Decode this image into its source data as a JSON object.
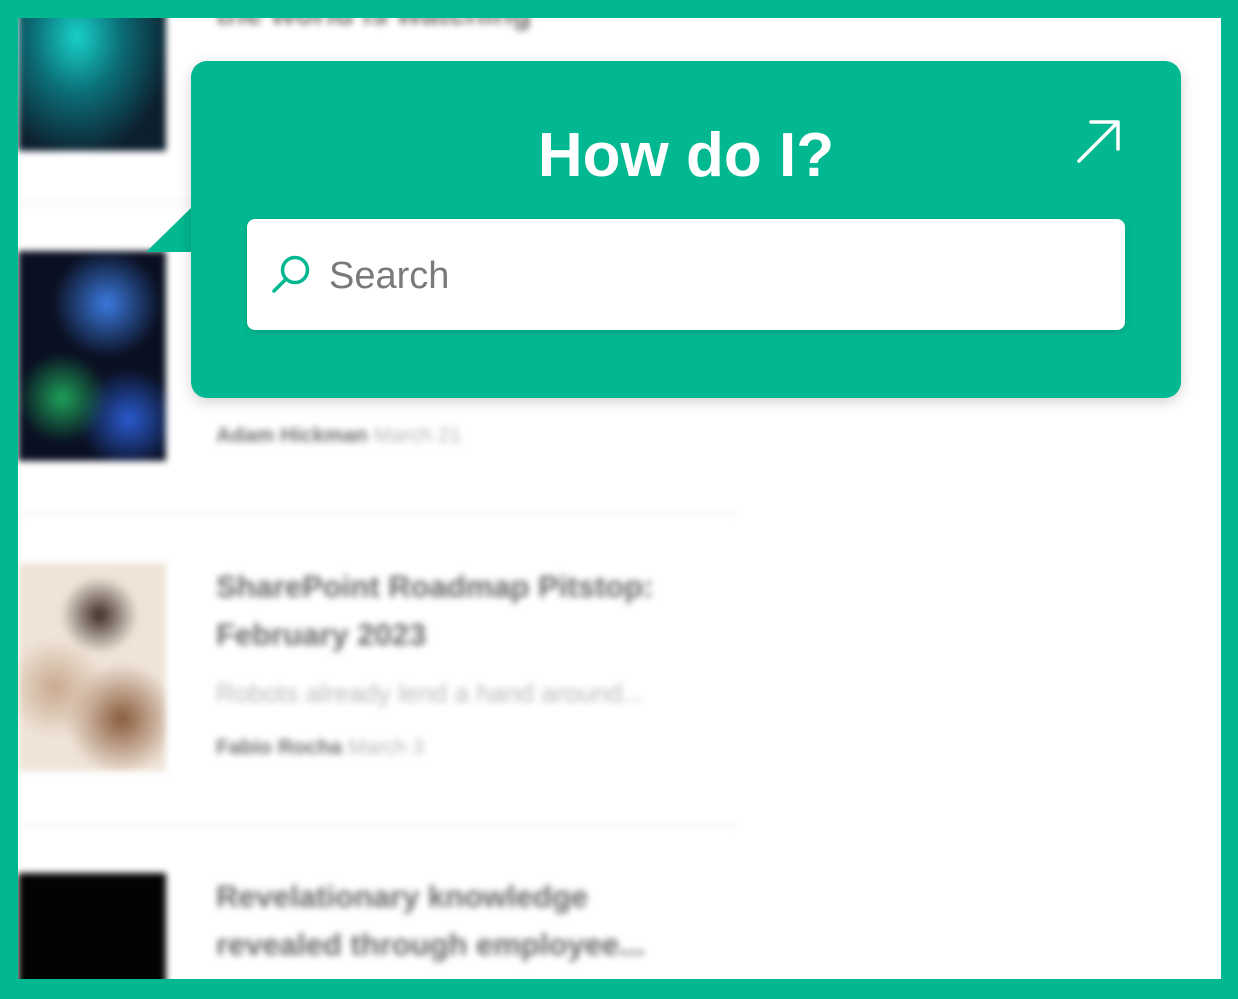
{
  "callout": {
    "title": "How do I?",
    "search_placeholder": "Search",
    "expand_icon": "arrow-up-right-icon",
    "accent_color": "#02b890"
  },
  "feed": {
    "items": [
      {
        "title_line2": "the world is watching"
      },
      {
        "author": "Adam Hickman",
        "date": "March 21"
      },
      {
        "title_line1": "SharePoint Roadmap Pitstop:",
        "title_line2": "February 2023",
        "description": "Robots already lend a hand around...",
        "author": "Fabio Rocha",
        "date": "March 3"
      },
      {
        "title_line1": "Revelationary knowledge",
        "title_line2": "revealed through employee..."
      }
    ]
  }
}
